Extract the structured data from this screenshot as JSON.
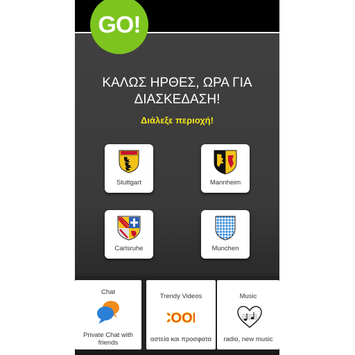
{
  "header": {
    "badge_text": "GO!",
    "welcome_line1": "ΚΑΛΩΣ ΗΡΘΕΣ, ΩΡΑ ΓΙΑ",
    "welcome_line2": "ΔΙΑΣΚΕΔΑΣΗ!",
    "choose_region": "Διάλεξε περιοχή!"
  },
  "cities": [
    {
      "label": "Stuttgart",
      "icon": "stuttgart-coat-of-arms-icon"
    },
    {
      "label": "Mannheim",
      "icon": "mannheim-coat-of-arms-icon"
    },
    {
      "label": "Carlsruhe",
      "icon": "karlsruhe-coat-of-arms-icon"
    },
    {
      "label": "Munchen",
      "icon": "munich-coat-of-arms-icon"
    }
  ],
  "features": [
    {
      "title": "Chat",
      "subtitle": "Private Chat with friends",
      "icon": "chat-bubbles-icon"
    },
    {
      "title": "Trendy Videos",
      "subtitle": "αστεία και προσφατα",
      "icon": "cool-video-icon"
    },
    {
      "title": "Music",
      "subtitle": "radio, new music",
      "icon": "music-heart-icon"
    }
  ],
  "colors": {
    "badge_green": "#7dc41f",
    "accent_yellow": "#f5e61c",
    "panel_dark": "#3d3d3d"
  }
}
